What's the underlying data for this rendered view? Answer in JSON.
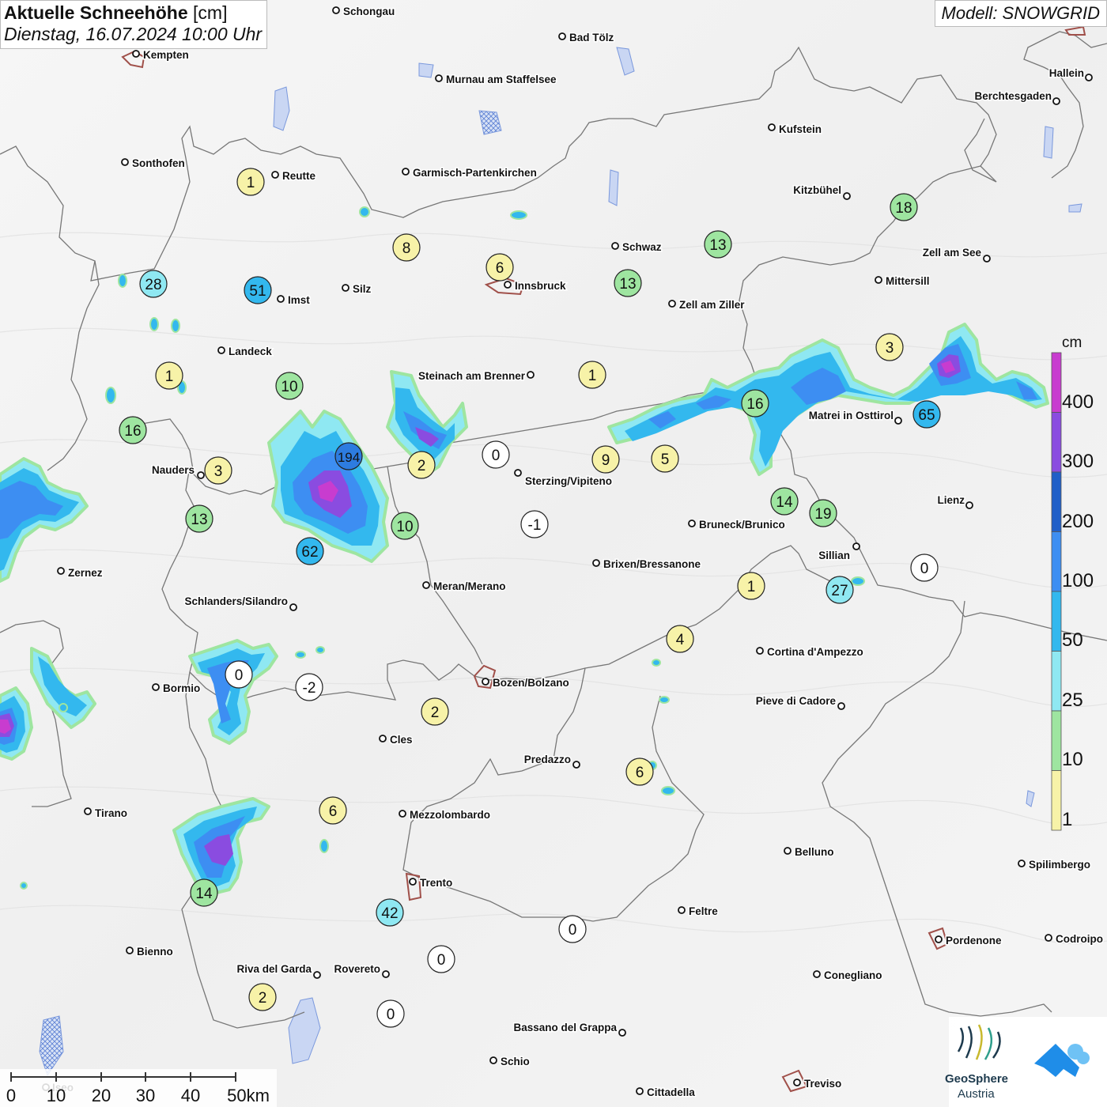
{
  "title": {
    "main": "Aktuelle Schneehöhe",
    "unit": "[cm]",
    "datetime": "Dienstag, 16.07.2024 10:00 Uhr"
  },
  "model_label": "Modell: SNOWGRID",
  "legend": {
    "unit": "cm",
    "labels": [
      "400",
      "300",
      "200",
      "100",
      "50",
      "25",
      "10",
      "1"
    ],
    "colors": [
      "#c83ccf",
      "#8a4ce0",
      "#1f5fc8",
      "#3d8ef2",
      "#33b8ee",
      "#8fe8f2",
      "#9ee5a0",
      "#f7f2a8"
    ]
  },
  "scale": {
    "labels": [
      "0",
      "10",
      "20",
      "30",
      "40",
      "50km"
    ]
  },
  "logos": {
    "name1": "GeoSphere",
    "name2": "Austria"
  },
  "cities": [
    {
      "name": "Schongau"
    },
    {
      "name": "Bad Tölz"
    },
    {
      "name": "Kempten"
    },
    {
      "name": "Murnau am Staffelsee"
    },
    {
      "name": "Hallein"
    },
    {
      "name": "Berchtesgaden"
    },
    {
      "name": "Kufstein"
    },
    {
      "name": "Sonthofen"
    },
    {
      "name": "Reutte"
    },
    {
      "name": "Garmisch-Partenkirchen"
    },
    {
      "name": "Kitzbühel"
    },
    {
      "name": "Schwaz"
    },
    {
      "name": "Zell am See"
    },
    {
      "name": "Innsbruck"
    },
    {
      "name": "Mittersill"
    },
    {
      "name": "Silz"
    },
    {
      "name": "Imst"
    },
    {
      "name": "Zell am Ziller"
    },
    {
      "name": "Landeck"
    },
    {
      "name": "Steinach am Brenner"
    },
    {
      "name": "Matrei in Osttirol"
    },
    {
      "name": "Nauders"
    },
    {
      "name": "Sterzing/Vipiteno"
    },
    {
      "name": "Lienz"
    },
    {
      "name": "Bruneck/Brunico"
    },
    {
      "name": "Sillian"
    },
    {
      "name": "Zernez"
    },
    {
      "name": "Brixen/Bressanone"
    },
    {
      "name": "Meran/Merano"
    },
    {
      "name": "Schlanders/Silandro"
    },
    {
      "name": "Cortina d'Ampezzo"
    },
    {
      "name": "Bozen/Bolzano"
    },
    {
      "name": "Bormio"
    },
    {
      "name": "Pieve di Cadore"
    },
    {
      "name": "Cles"
    },
    {
      "name": "Predazzo"
    },
    {
      "name": "Tirano"
    },
    {
      "name": "Mezzolombardo"
    },
    {
      "name": "Belluno"
    },
    {
      "name": "Spilimbergo"
    },
    {
      "name": "Trento"
    },
    {
      "name": "Feltre"
    },
    {
      "name": "Pordenone"
    },
    {
      "name": "Codroipo"
    },
    {
      "name": "Bienno"
    },
    {
      "name": "Riva del Garda"
    },
    {
      "name": "Rovereto"
    },
    {
      "name": "Conegliano"
    },
    {
      "name": "Bassano del Grappa"
    },
    {
      "name": "Schio"
    },
    {
      "name": "Treviso"
    },
    {
      "name": "Cittadella"
    },
    {
      "name": "Iseo"
    }
  ],
  "stations": [
    {
      "value": "1"
    },
    {
      "value": "8"
    },
    {
      "value": "6"
    },
    {
      "value": "13"
    },
    {
      "value": "13"
    },
    {
      "value": "18"
    },
    {
      "value": "28"
    },
    {
      "value": "51"
    },
    {
      "value": "1"
    },
    {
      "value": "10"
    },
    {
      "value": "1"
    },
    {
      "value": "3"
    },
    {
      "value": "16"
    },
    {
      "value": "16"
    },
    {
      "value": "65"
    },
    {
      "value": "3"
    },
    {
      "value": "194"
    },
    {
      "value": "2"
    },
    {
      "value": "0"
    },
    {
      "value": "9"
    },
    {
      "value": "5"
    },
    {
      "value": "13"
    },
    {
      "value": "10"
    },
    {
      "value": "-1"
    },
    {
      "value": "14"
    },
    {
      "value": "19"
    },
    {
      "value": "62"
    },
    {
      "value": "0"
    },
    {
      "value": "1"
    },
    {
      "value": "27"
    },
    {
      "value": "4"
    },
    {
      "value": "0"
    },
    {
      "value": "-2"
    },
    {
      "value": "2"
    },
    {
      "value": "6"
    },
    {
      "value": "6"
    },
    {
      "value": "14"
    },
    {
      "value": "42"
    },
    {
      "value": "0"
    },
    {
      "value": "0"
    },
    {
      "value": "2"
    },
    {
      "value": "0"
    }
  ]
}
